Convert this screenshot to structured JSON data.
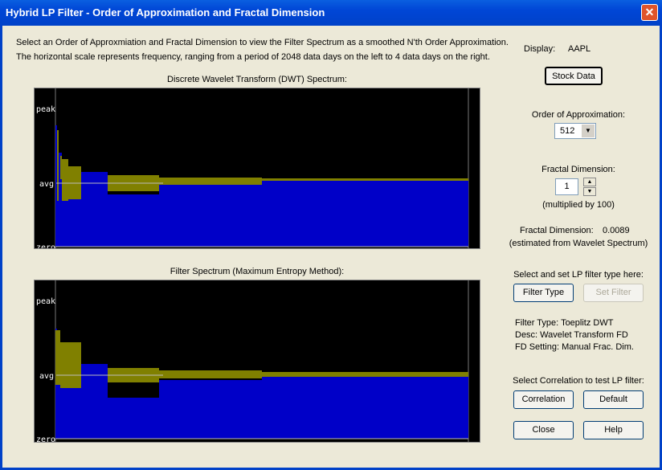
{
  "window": {
    "title": "Hybrid LP Filter - Order of Approximation and Fractal Dimension",
    "close_label": "✕"
  },
  "intro": {
    "line1": "Select an Order of Approxmiation and Fractal Dimension to view the Filter Spectrum as a smoothed N'th Order Approximation.",
    "line2": "The horizontal scale represents frequency, ranging from a period of 2048 data days on the left to 4 data days on the right."
  },
  "dwt": {
    "title": "Discrete Wavelet Transform (DWT) Spectrum:",
    "peak": "peak",
    "avg": "avg",
    "zero": "zero"
  },
  "filter": {
    "title": "Filter Spectrum (Maximum Entropy Method):",
    "peak": "peak",
    "avg": "avg",
    "zero": "zero"
  },
  "colors": {
    "spectrum": "#0000c8",
    "band": "#808000",
    "background": "#000000"
  },
  "right": {
    "display_label": "Display:",
    "display_value": "AAPL",
    "stock_data": "Stock Data",
    "order_label": "Order of Approximation:",
    "order_value": "512",
    "fd_label": "Fractal Dimension:",
    "fd_value": "1",
    "fd_note": "(multiplied by 100)",
    "fd_est_label": "Fractal Dimension:",
    "fd_est_value": "0.0089",
    "fd_est_note": "(estimated from Wavelet Spectrum)",
    "lp_prompt": "Select and set LP filter type here:",
    "filter_type": "Filter Type",
    "set_filter": "Set Filter",
    "ft_line": "Filter Type:  Toeplitz DWT",
    "desc_line": "Desc:  Wavelet Transform FD",
    "fd_setting_line": "FD Setting:  Manual Frac. Dim.",
    "corr_prompt": "Select Correlation to test LP filter:",
    "correlation": "Correlation",
    "default": "Default",
    "close": "Close",
    "help": "Help"
  }
}
